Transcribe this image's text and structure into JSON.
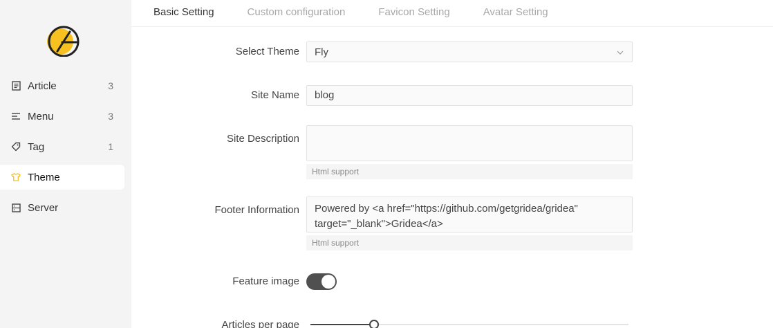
{
  "sidebar": {
    "logo_icon": "gridea-logo-icon",
    "items": [
      {
        "label": "Article",
        "count": "3",
        "icon": "article-icon"
      },
      {
        "label": "Menu",
        "count": "3",
        "icon": "menu-icon"
      },
      {
        "label": "Tag",
        "count": "1",
        "icon": "tag-icon"
      },
      {
        "label": "Theme",
        "count": "",
        "icon": "tshirt-icon",
        "active": true
      },
      {
        "label": "Server",
        "count": "",
        "icon": "server-icon"
      }
    ]
  },
  "tabs": [
    {
      "label": "Basic Setting",
      "active": true
    },
    {
      "label": "Custom configuration"
    },
    {
      "label": "Favicon Setting"
    },
    {
      "label": "Avatar Setting"
    }
  ],
  "form": {
    "theme": {
      "label": "Select Theme",
      "value": "Fly"
    },
    "site_name": {
      "label": "Site Name",
      "value": "blog"
    },
    "site_description": {
      "label": "Site Description",
      "value": "",
      "hint": "Html support"
    },
    "footer_info": {
      "label": "Footer Information",
      "value": "Powered by <a href=\"https://github.com/getgridea/gridea\" target=\"_blank\">Gridea</a>",
      "hint": "Html support"
    },
    "feature_image": {
      "label": "Feature image",
      "enabled": true
    },
    "articles_per_page": {
      "label": "Articles per page",
      "fraction": 0.2
    }
  },
  "colors": {
    "accent_yellow": "#f7c21f",
    "toggle_on": "#505050"
  }
}
